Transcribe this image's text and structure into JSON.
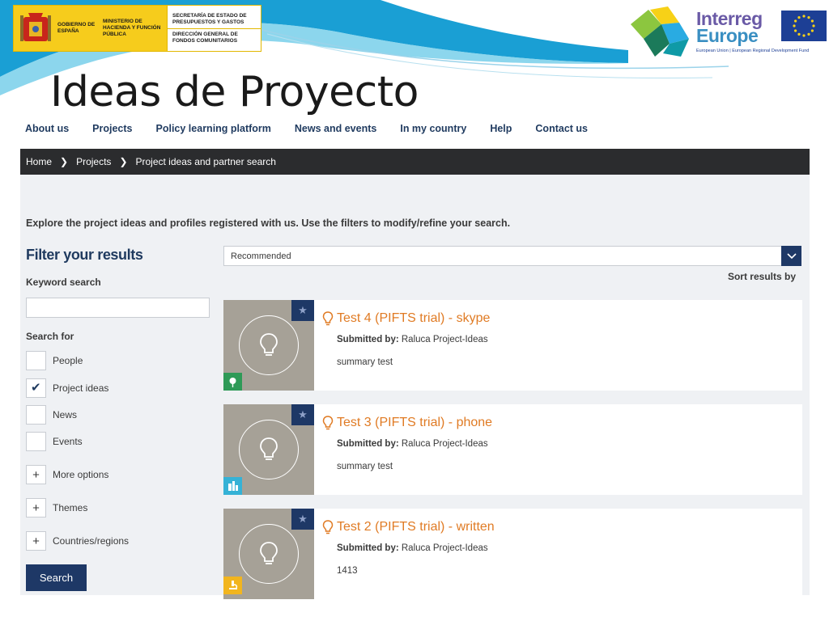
{
  "slide_title": "Ideas de Proyecto",
  "gov_logo": {
    "col1": "GOBIERNO DE ESPAÑA",
    "col2": "MINISTERIO DE HACIENDA Y FUNCIÓN PÚBLICA",
    "right_top": "SECRETARÍA DE ESTADO DE PRESUPUESTOS Y GASTOS",
    "right_bottom": "DIRECCIÓN GENERAL DE FONDOS COMUNITARIOS"
  },
  "interreg_logo": {
    "line1": "Interreg",
    "line2": "Europe",
    "caption": "European Union | European Regional Development Fund"
  },
  "nav": [
    "About us",
    "Projects",
    "Policy learning platform",
    "News and events",
    "In my country",
    "Help",
    "Contact us"
  ],
  "breadcrumb": [
    "Home",
    "Projects",
    "Project ideas and partner search"
  ],
  "intro": "Explore the project ideas and profiles registered with us. Use the filters to modify/refine your search.",
  "filters": {
    "title": "Filter your results",
    "keyword_label": "Keyword search",
    "keyword_value": "",
    "search_for_label": "Search for",
    "checkboxes": [
      {
        "label": "People",
        "checked": false
      },
      {
        "label": "Project ideas",
        "checked": true
      },
      {
        "label": "News",
        "checked": false
      },
      {
        "label": "Events",
        "checked": false
      }
    ],
    "expanders": [
      "More options",
      "Themes",
      "Countries/regions"
    ],
    "search_button": "Search"
  },
  "sort": {
    "selected": "Recommended",
    "label": "Sort results by"
  },
  "colors": {
    "navy": "#1e3866",
    "orange": "#e07b24",
    "thumb_gray": "#a6a197",
    "badge_green": "#2e9a57",
    "badge_cyan": "#35b2d6",
    "badge_yellow": "#f2b51e"
  },
  "results": [
    {
      "title": "Test 4 (PIFTS trial) - skype",
      "submitted_label": "Submitted by:",
      "submitted_by": "Raluca Project-Ideas",
      "summary": "summary test",
      "badge_icon": "environment-icon",
      "badge_color": "#2e9a57"
    },
    {
      "title": "Test 3 (PIFTS trial) - phone",
      "submitted_label": "Submitted by:",
      "submitted_by": "Raluca Project-Ideas",
      "summary": "summary test",
      "badge_icon": "city-icon",
      "badge_color": "#35b2d6"
    },
    {
      "title": "Test 2 (PIFTS trial) - written",
      "submitted_label": "Submitted by:",
      "submitted_by": "Raluca Project-Ideas",
      "summary": "1413",
      "badge_icon": "research-icon",
      "badge_color": "#f2b51e"
    }
  ]
}
